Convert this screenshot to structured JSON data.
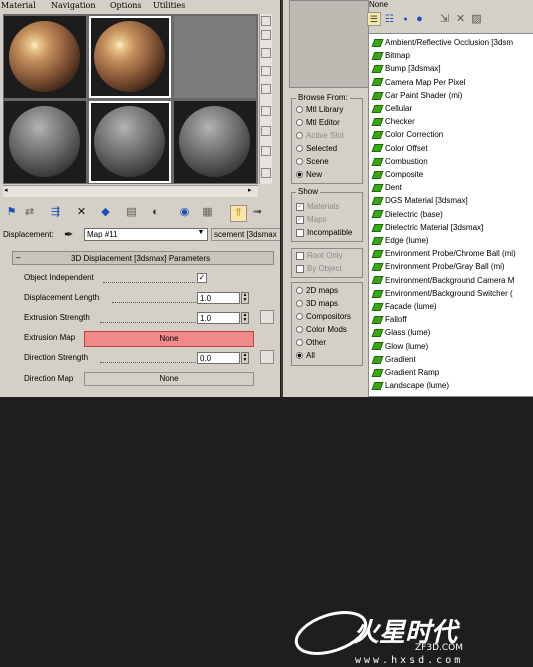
{
  "menu": [
    "Material",
    "Navigation",
    "Options",
    "Utilities"
  ],
  "toolbar_icons": [
    "get-material-icon",
    "put-material-icon",
    "assign-icon",
    "delete-icon",
    "make-unique-icon",
    "put-library-icon",
    "material-id-icon",
    "show-map-icon",
    "show-end-result-icon",
    "go-to-parent-icon",
    "go-sibling-icon"
  ],
  "displacement": {
    "label": "Displacement:",
    "map_name": "Map #11",
    "map_type": "scement [3dsmax"
  },
  "rollout": {
    "title": "3D Displacement [3dsmax] Parameters",
    "object_independent_label": "Object Independent",
    "object_independent_checked": "✓",
    "displacement_length_label": "Displacement Length",
    "displacement_length_value": "1.0",
    "extrusion_strength_label": "Extrusion Strength",
    "extrusion_strength_value": "1.0",
    "extrusion_map_label": "Extrusion Map",
    "extrusion_map_value": "None",
    "direction_strength_label": "Direction Strength",
    "direction_strength_value": "0.0",
    "direction_map_label": "Direction Map",
    "direction_map_value": "None"
  },
  "browser": {
    "header_value": "None",
    "browse_from": {
      "title": "Browse From:",
      "options": [
        {
          "label": "Mtl Library",
          "selected": false,
          "disabled": false
        },
        {
          "label": "Mtl Editor",
          "selected": false,
          "disabled": false
        },
        {
          "label": "Active Slot",
          "selected": false,
          "disabled": true
        },
        {
          "label": "Selected",
          "selected": false,
          "disabled": false
        },
        {
          "label": "Scene",
          "selected": false,
          "disabled": false
        },
        {
          "label": "New",
          "selected": true,
          "disabled": false
        }
      ]
    },
    "show": {
      "title": "Show",
      "options": [
        {
          "label": "Materials",
          "checked": true,
          "disabled": true
        },
        {
          "label": "Maps",
          "checked": true,
          "disabled": true
        },
        {
          "label": "Incompatible",
          "checked": false,
          "disabled": false
        }
      ]
    },
    "root": {
      "options": [
        {
          "label": "Root Only",
          "disabled": true
        },
        {
          "label": "By Object",
          "disabled": true
        }
      ]
    },
    "filter": {
      "options": [
        {
          "label": "2D maps",
          "selected": false
        },
        {
          "label": "3D maps",
          "selected": false
        },
        {
          "label": "Compositors",
          "selected": false
        },
        {
          "label": "Color Mods",
          "selected": false
        },
        {
          "label": "Other",
          "selected": false
        },
        {
          "label": "All",
          "selected": true
        }
      ]
    },
    "list": [
      "Ambient/Reflective Occlusion [3dsm",
      "Bitmap",
      "Bump [3dsmax]",
      "Camera Map Per Pixel",
      "Car Paint Shader (mi)",
      "Cellular",
      "Checker",
      "Color Correction",
      "Color Offset",
      "Combustion",
      "Composite",
      "Dent",
      "DGS Material [3dsmax]",
      "Dielectric (base)",
      "Dielectric Material [3dsmax]",
      "Edge (lume)",
      "Environment Probe/Chrome Ball (mi)",
      "Environment Probe/Gray Ball (mi)",
      "Environment/Background Camera M",
      "Environment/Background Switcher (",
      "Facade (lume)",
      "Falloff",
      "Glass (lume)",
      "Glow (lume)",
      "Gradient",
      "Gradient Ramp",
      "Landscape (lume)"
    ]
  },
  "watermark": {
    "brand": "火星时代",
    "site_cn": "ZF3D.COM",
    "url": "www.hxsd.com"
  },
  "colors": {
    "panel": "#d4d0c8",
    "extrusion_map_highlight": "#f08a8a",
    "map_icon": "#3aa617",
    "background": "#1e1e1e"
  }
}
